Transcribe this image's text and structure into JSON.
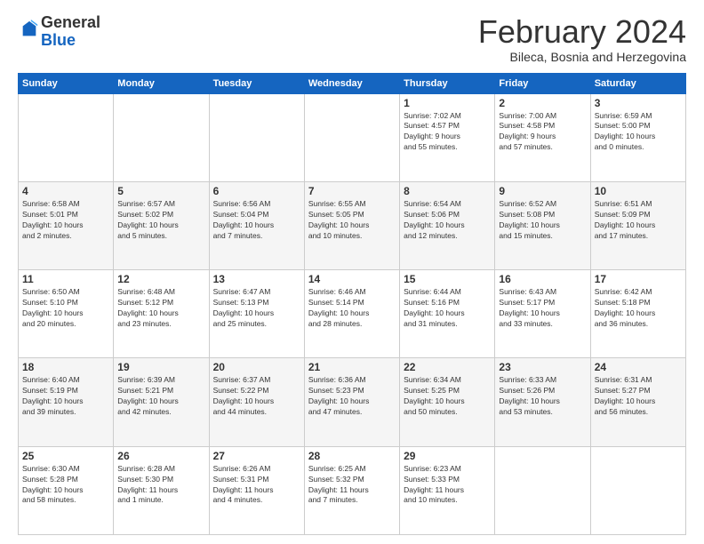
{
  "header": {
    "logo_general": "General",
    "logo_blue": "Blue",
    "title": "February 2024",
    "subtitle": "Bileca, Bosnia and Herzegovina"
  },
  "days_of_week": [
    "Sunday",
    "Monday",
    "Tuesday",
    "Wednesday",
    "Thursday",
    "Friday",
    "Saturday"
  ],
  "weeks": [
    [
      {
        "day": "",
        "info": ""
      },
      {
        "day": "",
        "info": ""
      },
      {
        "day": "",
        "info": ""
      },
      {
        "day": "",
        "info": ""
      },
      {
        "day": "1",
        "info": "Sunrise: 7:02 AM\nSunset: 4:57 PM\nDaylight: 9 hours\nand 55 minutes."
      },
      {
        "day": "2",
        "info": "Sunrise: 7:00 AM\nSunset: 4:58 PM\nDaylight: 9 hours\nand 57 minutes."
      },
      {
        "day": "3",
        "info": "Sunrise: 6:59 AM\nSunset: 5:00 PM\nDaylight: 10 hours\nand 0 minutes."
      }
    ],
    [
      {
        "day": "4",
        "info": "Sunrise: 6:58 AM\nSunset: 5:01 PM\nDaylight: 10 hours\nand 2 minutes."
      },
      {
        "day": "5",
        "info": "Sunrise: 6:57 AM\nSunset: 5:02 PM\nDaylight: 10 hours\nand 5 minutes."
      },
      {
        "day": "6",
        "info": "Sunrise: 6:56 AM\nSunset: 5:04 PM\nDaylight: 10 hours\nand 7 minutes."
      },
      {
        "day": "7",
        "info": "Sunrise: 6:55 AM\nSunset: 5:05 PM\nDaylight: 10 hours\nand 10 minutes."
      },
      {
        "day": "8",
        "info": "Sunrise: 6:54 AM\nSunset: 5:06 PM\nDaylight: 10 hours\nand 12 minutes."
      },
      {
        "day": "9",
        "info": "Sunrise: 6:52 AM\nSunset: 5:08 PM\nDaylight: 10 hours\nand 15 minutes."
      },
      {
        "day": "10",
        "info": "Sunrise: 6:51 AM\nSunset: 5:09 PM\nDaylight: 10 hours\nand 17 minutes."
      }
    ],
    [
      {
        "day": "11",
        "info": "Sunrise: 6:50 AM\nSunset: 5:10 PM\nDaylight: 10 hours\nand 20 minutes."
      },
      {
        "day": "12",
        "info": "Sunrise: 6:48 AM\nSunset: 5:12 PM\nDaylight: 10 hours\nand 23 minutes."
      },
      {
        "day": "13",
        "info": "Sunrise: 6:47 AM\nSunset: 5:13 PM\nDaylight: 10 hours\nand 25 minutes."
      },
      {
        "day": "14",
        "info": "Sunrise: 6:46 AM\nSunset: 5:14 PM\nDaylight: 10 hours\nand 28 minutes."
      },
      {
        "day": "15",
        "info": "Sunrise: 6:44 AM\nSunset: 5:16 PM\nDaylight: 10 hours\nand 31 minutes."
      },
      {
        "day": "16",
        "info": "Sunrise: 6:43 AM\nSunset: 5:17 PM\nDaylight: 10 hours\nand 33 minutes."
      },
      {
        "day": "17",
        "info": "Sunrise: 6:42 AM\nSunset: 5:18 PM\nDaylight: 10 hours\nand 36 minutes."
      }
    ],
    [
      {
        "day": "18",
        "info": "Sunrise: 6:40 AM\nSunset: 5:19 PM\nDaylight: 10 hours\nand 39 minutes."
      },
      {
        "day": "19",
        "info": "Sunrise: 6:39 AM\nSunset: 5:21 PM\nDaylight: 10 hours\nand 42 minutes."
      },
      {
        "day": "20",
        "info": "Sunrise: 6:37 AM\nSunset: 5:22 PM\nDaylight: 10 hours\nand 44 minutes."
      },
      {
        "day": "21",
        "info": "Sunrise: 6:36 AM\nSunset: 5:23 PM\nDaylight: 10 hours\nand 47 minutes."
      },
      {
        "day": "22",
        "info": "Sunrise: 6:34 AM\nSunset: 5:25 PM\nDaylight: 10 hours\nand 50 minutes."
      },
      {
        "day": "23",
        "info": "Sunrise: 6:33 AM\nSunset: 5:26 PM\nDaylight: 10 hours\nand 53 minutes."
      },
      {
        "day": "24",
        "info": "Sunrise: 6:31 AM\nSunset: 5:27 PM\nDaylight: 10 hours\nand 56 minutes."
      }
    ],
    [
      {
        "day": "25",
        "info": "Sunrise: 6:30 AM\nSunset: 5:28 PM\nDaylight: 10 hours\nand 58 minutes."
      },
      {
        "day": "26",
        "info": "Sunrise: 6:28 AM\nSunset: 5:30 PM\nDaylight: 11 hours\nand 1 minute."
      },
      {
        "day": "27",
        "info": "Sunrise: 6:26 AM\nSunset: 5:31 PM\nDaylight: 11 hours\nand 4 minutes."
      },
      {
        "day": "28",
        "info": "Sunrise: 6:25 AM\nSunset: 5:32 PM\nDaylight: 11 hours\nand 7 minutes."
      },
      {
        "day": "29",
        "info": "Sunrise: 6:23 AM\nSunset: 5:33 PM\nDaylight: 11 hours\nand 10 minutes."
      },
      {
        "day": "",
        "info": ""
      },
      {
        "day": "",
        "info": ""
      }
    ]
  ]
}
